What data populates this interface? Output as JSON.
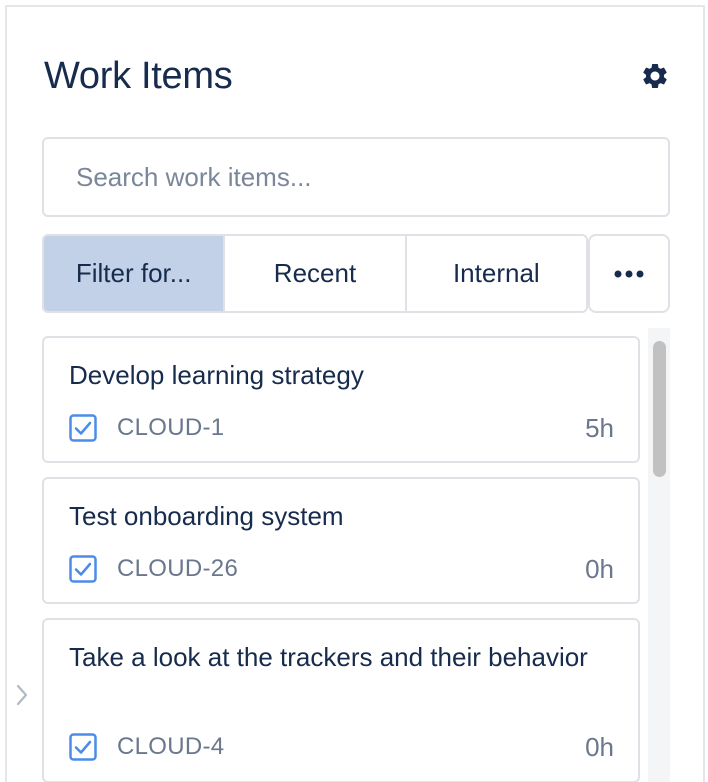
{
  "header": {
    "title": "Work Items",
    "settings_icon": "gear-icon"
  },
  "search": {
    "placeholder": "Search work items...",
    "value": ""
  },
  "tabs": [
    {
      "label": "Filter for...",
      "active": true
    },
    {
      "label": "Recent",
      "active": false
    },
    {
      "label": "Internal",
      "active": false
    }
  ],
  "more_icon": "more-horizontal-icon",
  "items": [
    {
      "title": "Develop learning strategy",
      "key": "CLOUD-1",
      "estimate": "5h",
      "type_icon": "checkbox-checked-icon"
    },
    {
      "title": "Test onboarding system",
      "key": "CLOUD-26",
      "estimate": "0h",
      "type_icon": "checkbox-checked-icon"
    },
    {
      "title": "Take a look at the trackers and their behavior",
      "key": "CLOUD-4",
      "estimate": "0h",
      "type_icon": "checkbox-checked-icon"
    }
  ],
  "colors": {
    "text": "#172b4d",
    "muted": "#6b778c",
    "active_tab": "#c2d1e8",
    "task_icon": "#4c8be8",
    "border": "#dfe1e6"
  }
}
